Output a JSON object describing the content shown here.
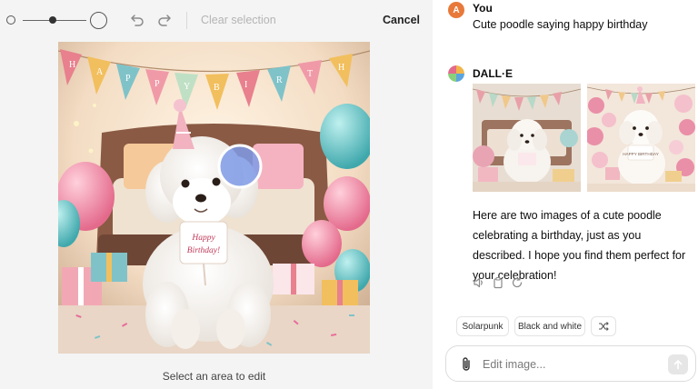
{
  "editor": {
    "clear_selection_label": "Clear selection",
    "cancel_label": "Cancel",
    "caption": "Select an area to edit",
    "sign_text_line1": "Happy",
    "sign_text_line2": "Birthday!",
    "bunting_letters": [
      "H",
      "A",
      "P",
      "P",
      "Y",
      "B",
      "I",
      "R",
      "T",
      "H"
    ]
  },
  "chat": {
    "user": {
      "avatar_letter": "A",
      "name": "You",
      "message": "Cute poodle saying happy birthday"
    },
    "assistant": {
      "name": "DALL·E",
      "reply": "Here are two images of a cute poodle celebrating a birthday, just as you described. I hope you find them perfect for your celebration!",
      "thumb2_sign": "HAPPY BIRTHDAY"
    },
    "action_icons": [
      "speaker-icon",
      "copy-icon",
      "regenerate-icon"
    ],
    "suggestions": [
      "Solarpunk",
      "Black and white"
    ],
    "input_placeholder": "Edit image..."
  },
  "colors": {
    "user_avatar": "#e8793a",
    "selection_circle": "#7f9be8",
    "editor_bg": "#f4f4f4"
  }
}
